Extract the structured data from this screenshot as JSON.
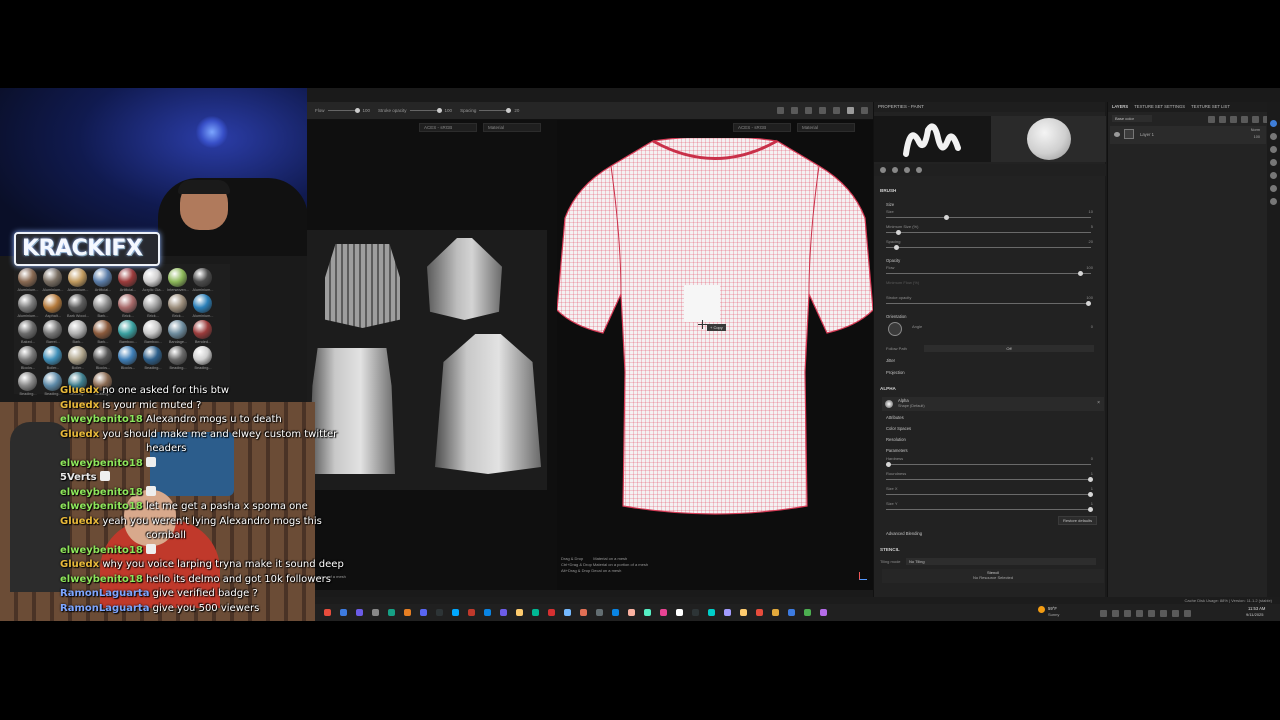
{
  "toolbar": {
    "flow_label": "Flow",
    "flow_value": "100",
    "stroke_opacity_label": "Stroke opacity",
    "stroke_opacity_value": "100",
    "spacing_label": "Spacing",
    "spacing_value": "20"
  },
  "viewports": {
    "uv": {
      "colorspace": "ACES - sRGB",
      "channel": "Material"
    },
    "mesh": {
      "colorspace": "ACES - sRGB",
      "channel": "Material"
    },
    "hint_line1": "Drag & Drop",
    "hint_line1b": "Material on a mesh",
    "hint_line2": "Ctrl+Drag & Drop",
    "hint_line2b": "Material on a portion of a mesh",
    "hint_line3": "Alt+Drag & Drop",
    "hint_line3b": "Decal on a mesh",
    "uv_hint": "portion of a mesh",
    "cursor_tip": "+ Copy"
  },
  "properties": {
    "title": "PROPERTIES - PAINT",
    "brush_section": "BRUSH",
    "size_group": "Size",
    "size_label": "Size",
    "size_value": "10",
    "min_size_label": "Minimum Size (%)",
    "min_size_value": "5",
    "spacing_label": "Spacing",
    "spacing_value": "20",
    "opacity_group": "Opacity",
    "flow_label": "Flow",
    "flow_value": "100",
    "min_flow_label": "Minimum Flow (%)",
    "stroke_opacity_label": "Stroke opacity",
    "stroke_opacity_value": "100",
    "orientation_group": "Orientation",
    "angle_label": "Angle",
    "angle_value": "0",
    "follow_path_label": "Follow Path",
    "follow_path_value": "Off",
    "jitter_group": "Jitter",
    "projection_group": "Projection",
    "alpha_section": "ALPHA",
    "alpha_name": "Alpha",
    "alpha_sub": "Shape (Default)",
    "attributes": "Attributes",
    "color_spaces": "Color Spaces",
    "resolution": "Resolution",
    "parameters": "Parameters",
    "hardness_label": "Hardness",
    "hardness_value": "0",
    "roundness_label": "Roundness",
    "roundness_value": "1",
    "size_x_label": "Size X",
    "size_x_value": "1",
    "size_y_label": "Size Y",
    "size_y_value": "1",
    "restore_defaults": "Restore defaults",
    "advanced_blending": "Advanced Blending",
    "stencil_section": "STENCIL",
    "tiling_mode_label": "Tiling mode",
    "tiling_mode_value": "No Tiling",
    "stencil_name": "Stencil",
    "stencil_none": "No Resource Selected"
  },
  "layers": {
    "tab_layers": "LAYERS",
    "tab_texture_set_settings": "TEXTURE SET SETTINGS",
    "tab_texture_set_list": "TEXTURE SET LIST",
    "channel": "Base color",
    "blend_mode": "Norm",
    "opacity_value": "100",
    "layer_name": "Layer 1"
  },
  "status": {
    "message": "Stats: 182 FPS - 4k of memory is being used, textures are built and pushed on the stack and updated",
    "right_text": "Cache Disk Usage: 88% | Version: 11.1.2 (stable)"
  },
  "taskbar": {
    "search_label": "Search",
    "weather_temp": "59°F",
    "weather_desc": "Sunny",
    "clock_time": "11:53 AM",
    "clock_date": "9/11/2025"
  },
  "stream": {
    "logo_text": "KRACKIFX",
    "materials": [
      "Aluminium...",
      "Aluminium...",
      "Aluminium...",
      "Artificial...",
      "Artificial...",
      "Acrylic Gla...",
      "Interwoven...",
      "Aluminium...",
      "Aluminium...",
      "Asphalt...",
      "Bark Wood...",
      "Bark...",
      "Brick...",
      "Brick...",
      "Brick...",
      "Aluminium...",
      "Baked...",
      "Barrel...",
      "Bark...",
      "Bark...",
      "Bamboo...",
      "Bamboo...",
      "Bandage...",
      "Bended...",
      "Blocks...",
      "Boiler...",
      "Boiler...",
      "Blocks...",
      "Blocks...",
      "Beading...",
      "Beading...",
      "Beading...",
      "Beading...",
      "Beading...",
      "Beading...",
      "Beading..."
    ],
    "chat": [
      {
        "user": "Gluedx",
        "msg": "no one asked for this btw",
        "color": "#e8b93a"
      },
      {
        "user": "Gluedx",
        "msg": "is your mic muted ?",
        "color": "#e8b93a"
      },
      {
        "user": "elweybenito18",
        "msg": "Alexandro mogs u to death",
        "color": "#8ee65b"
      },
      {
        "user": "Gluedx",
        "msg": "you should make me and elwey custom twitter",
        "color": "#e8b93a"
      },
      {
        "user": "",
        "msg": "headers",
        "color": "#e8b93a"
      },
      {
        "user": "elweybenito18",
        "msg": "",
        "color": "#8ee65b"
      },
      {
        "user": "5Verts",
        "msg": "",
        "color": "#e8e8e8"
      },
      {
        "user": "elweybenito18",
        "msg": "",
        "color": "#8ee65b"
      },
      {
        "user": "elweybenito18",
        "msg": "let me get a pasha x spoma one",
        "color": "#8ee65b"
      },
      {
        "user": "Gluedx",
        "msg": "yeah you weren't lying Alexandro mogs this",
        "color": "#e8b93a"
      },
      {
        "user": "",
        "msg": "cornball",
        "color": "#e8b93a"
      },
      {
        "user": "elweybenito18",
        "msg": "",
        "color": "#8ee65b"
      },
      {
        "user": "Gluedx",
        "msg": "why you voice larping tryna make it sound deep",
        "color": "#e8b93a"
      },
      {
        "user": "elweybenito18",
        "msg": "hello its delmo and got 10k followers",
        "color": "#8ee65b"
      },
      {
        "user": "RamonLaguarta",
        "msg": "give verified badge ?",
        "color": "#7ea6ff"
      },
      {
        "user": "RamonLaguarta",
        "msg": "give you 500 viewers",
        "color": "#7ea6ff"
      }
    ]
  }
}
